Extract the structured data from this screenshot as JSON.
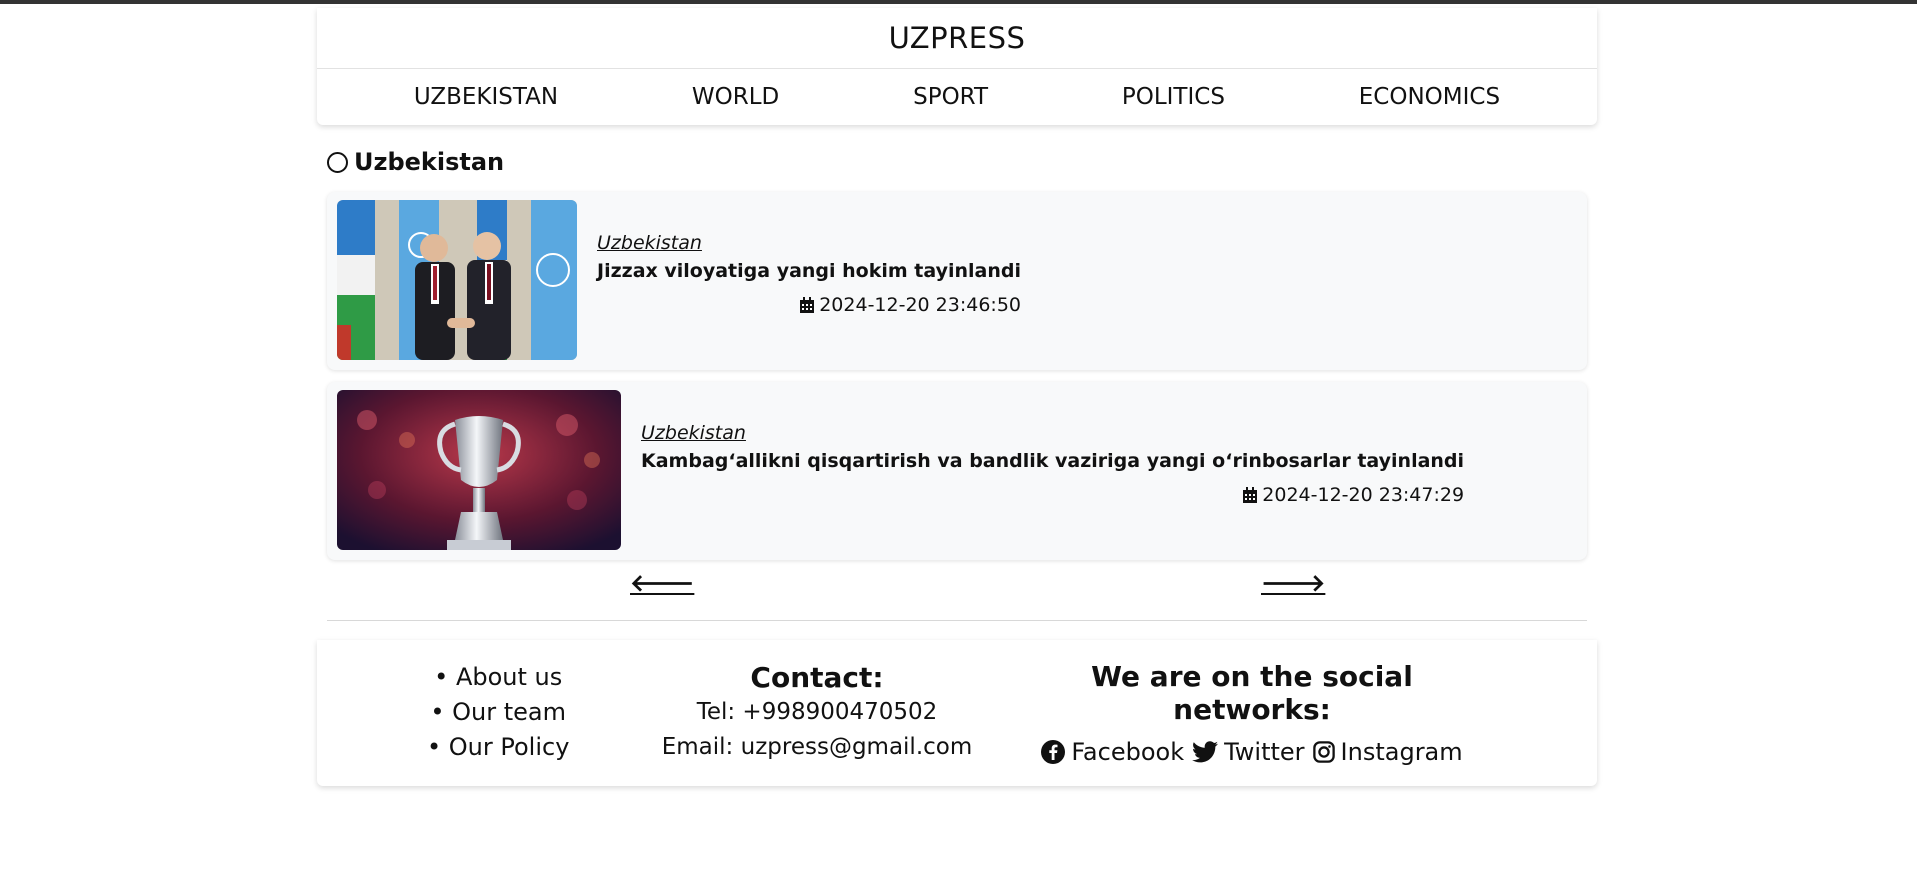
{
  "brand": "UZPRESS",
  "nav": [
    "UZBEKISTAN",
    "WORLD",
    "SPORT",
    "POLITICS",
    "ECONOMICS"
  ],
  "section_title": "Uzbekistan",
  "articles": [
    {
      "category": "Uzbekistan",
      "title": "Jizzax viloyatiga yangi hokim tayinlandi",
      "date": "2024-12-20 23:46:50",
      "image": "two-men-handshake-flags-photo"
    },
    {
      "category": "Uzbekistan",
      "title": "Kambag‘allikni qisqartirish va bandlik vaziriga yangi o‘rinbosarlar tayinlandi",
      "date": "2024-12-20 23:47:29",
      "image": "silver-trophy-photo"
    }
  ],
  "pager": {
    "prev": "🡐",
    "next": "🡒"
  },
  "footer": {
    "links": [
      "• About us",
      "• Our team",
      "• Our Policy"
    ],
    "contact": {
      "heading": "Contact:",
      "tel": "Tel: +998900470502",
      "email": "Email: uzpress@gmail.com"
    },
    "social": {
      "heading": "We are on the social networks:",
      "facebook": "Facebook",
      "twitter": "Twitter",
      "instagram": "Instagram"
    }
  }
}
